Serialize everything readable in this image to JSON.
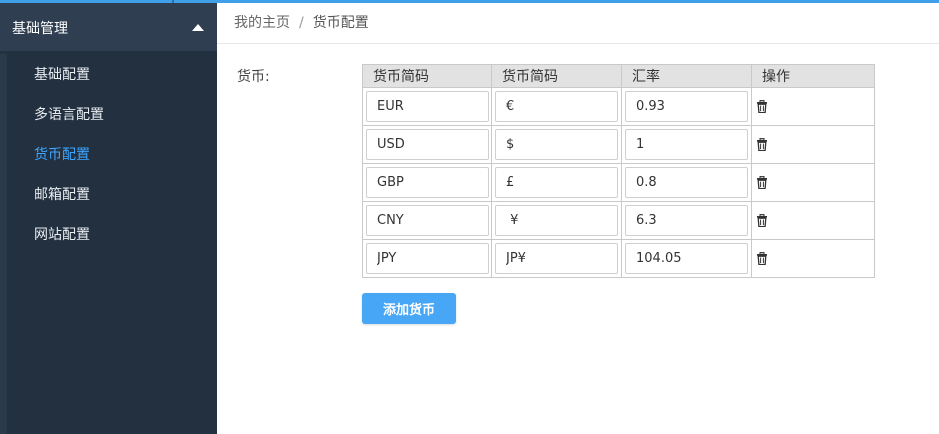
{
  "sidebar": {
    "header": "基础管理",
    "items": [
      {
        "label": "基础配置",
        "active": false
      },
      {
        "label": "多语言配置",
        "active": false
      },
      {
        "label": "货币配置",
        "active": true
      },
      {
        "label": "邮箱配置",
        "active": false
      },
      {
        "label": "网站配置",
        "active": false
      }
    ]
  },
  "breadcrumb": {
    "home": "我的主页",
    "separator": "/",
    "current": "货币配置"
  },
  "form": {
    "currency_label": "货币:"
  },
  "table": {
    "headers": [
      "货币简码",
      "货币简码",
      "汇率",
      "操作"
    ],
    "rows": [
      {
        "code": "EUR",
        "symbol": "€",
        "rate": "0.93"
      },
      {
        "code": "USD",
        "symbol": "$",
        "rate": "1"
      },
      {
        "code": "GBP",
        "symbol": "£",
        "rate": "0.8"
      },
      {
        "code": "CNY",
        "symbol": " ¥",
        "rate": "6.3"
      },
      {
        "code": "JPY",
        "symbol": "JP¥",
        "rate": "104.05"
      }
    ],
    "delete_icon": "trash-icon"
  },
  "add_button": "添加货币",
  "colors": {
    "accent": "#3f9fe8",
    "sidebar_bg": "#22303f",
    "active_item": "#3fa6ff",
    "button": "#47a6f5"
  }
}
